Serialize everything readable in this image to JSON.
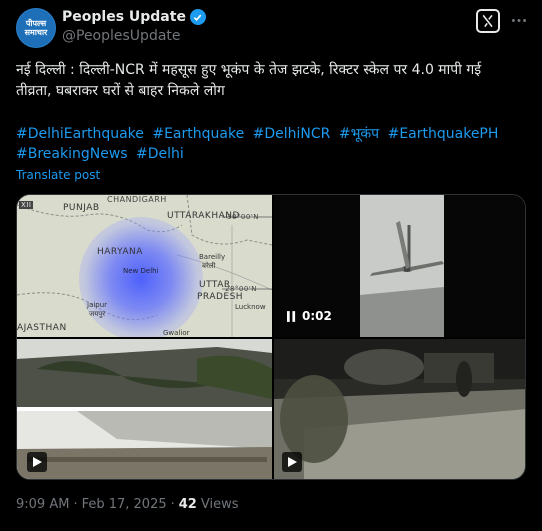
{
  "author": {
    "avatar_line1": "पीपल्स",
    "avatar_line2": "समाचार",
    "name": "Peoples Update",
    "handle": "@PeoplesUpdate"
  },
  "tweet": {
    "text": "नई दिल्ली : दिल्ली-NCR में महसूस हुए भूकंप के तेज झटके, रिक्टर स्केल पर 4.0 मापी गई तीव्रता, घबराकर घरों से बाहर निकले लोग",
    "hashtags": [
      "#DelhiEarthquake",
      "#Earthquake",
      "#DelhiNCR",
      "#भूकंप",
      "#EarthquakePH",
      "#BreakingNews",
      "#Delhi"
    ],
    "translate_label": "Translate post"
  },
  "media": {
    "map_labels": {
      "punjab": "PUNJAB",
      "uttarakhand": "UTTARAKHAND",
      "haryana": "HARYANA",
      "new_delhi": "New Delhi",
      "bareilly": "Bareilly",
      "bareilly_hi": "बरेली",
      "uttar": "UTTAR",
      "pradesh": "PRADESH",
      "jaipur": "Jaipur",
      "jaipur_hi": "जयपुर",
      "lucknow": "Lucknow",
      "rajasthan": "AJASTHAN",
      "gwalior": "Gwalior",
      "chandigarh": "CHANDIGARH",
      "coord1": "30°00'N",
      "coord2": "28°00'N",
      "xii": "XII"
    },
    "video_timer": "0:02"
  },
  "footer": {
    "time": "9:09 AM",
    "sep": "·",
    "date": "Feb 17, 2025",
    "sep2": "·",
    "views_count": "42",
    "views_label": "Views"
  },
  "colors": {
    "link": "#1d9bf0",
    "muted": "#71767b",
    "text": "#e7e9ea"
  }
}
